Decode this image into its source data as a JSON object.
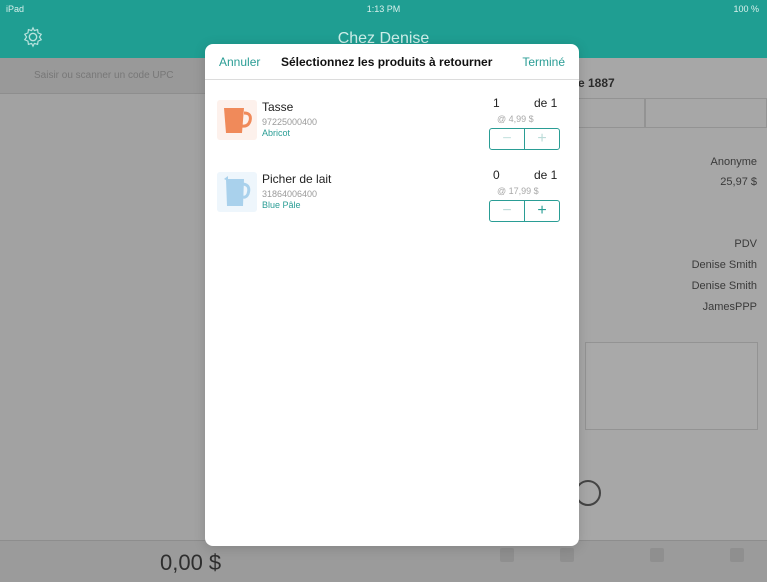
{
  "status_bar": {
    "left": "iPad",
    "time": "1:13 PM",
    "right": "100 %"
  },
  "app": {
    "title": "Chez Denise",
    "gear_icon": "gear-icon"
  },
  "search": {
    "placeholder": "Saisir ou scanner un code UPC"
  },
  "order": {
    "header": "e 1887",
    "customer": "Anonyme",
    "amount": "25,97 $",
    "channel": "PDV",
    "employee_1": "Denise Smith",
    "employee_2": "Denise Smith",
    "register": "JamesPPP"
  },
  "footer": {
    "total": "0,00 $"
  },
  "modal": {
    "cancel_label": "Annuler",
    "title": "Sélectionnez les produits à retourner",
    "done_label": "Terminé",
    "items": [
      {
        "name": "Tasse",
        "sku": "97225000400",
        "variant": "Abricot",
        "quantity": "1",
        "of_total": "de 1",
        "price": "@ 4,99 $",
        "thumb_color": "#f08a5a",
        "icon": "mug-icon"
      },
      {
        "name": "Picher de lait",
        "sku": "31864006400",
        "variant": "Blue Pâle",
        "quantity": "0",
        "of_total": "de 1",
        "price": "@ 17,99 $",
        "thumb_color": "#a9d1ec",
        "icon": "pitcher-icon"
      }
    ],
    "stepper": {
      "minus": "−",
      "plus": "+"
    }
  },
  "colors": {
    "accent": "#2a9d95",
    "nav": "#1f9e92"
  }
}
